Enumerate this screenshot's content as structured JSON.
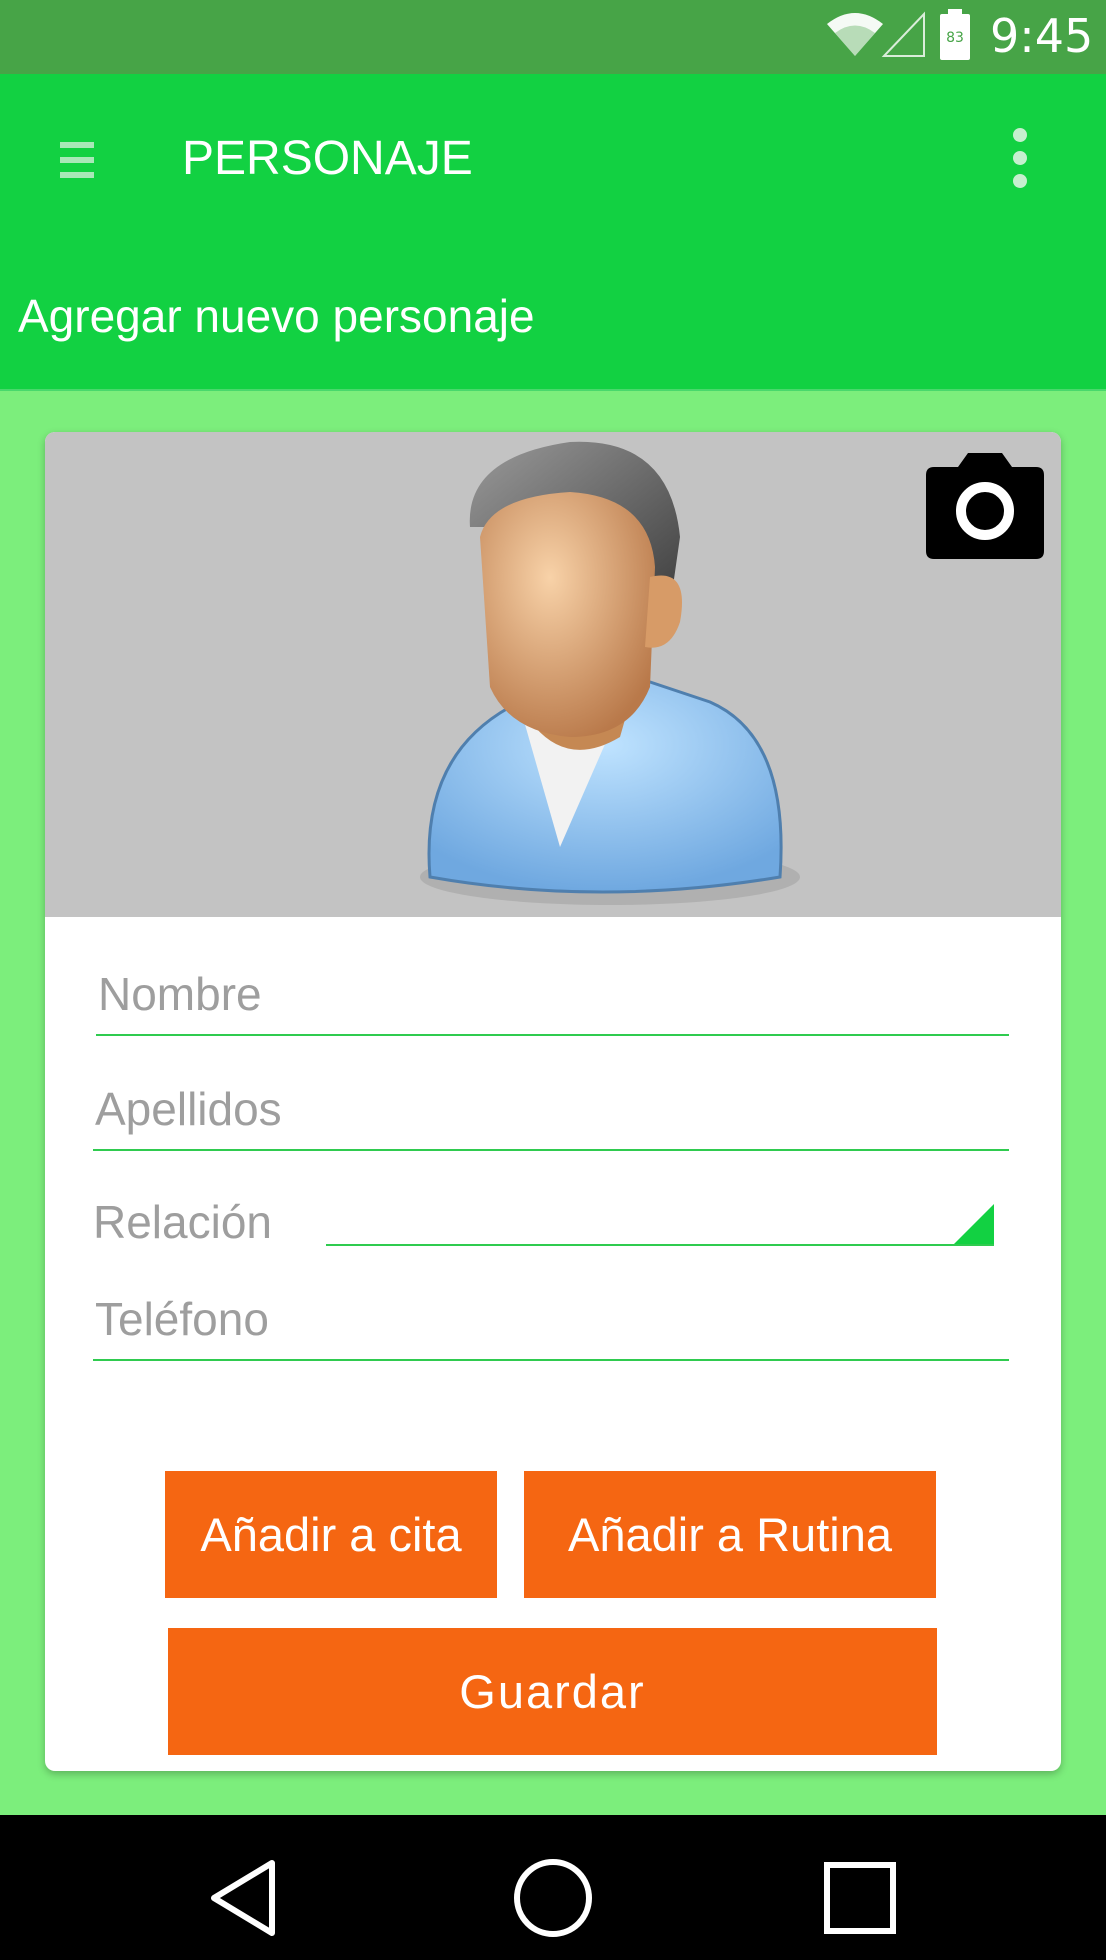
{
  "status_bar": {
    "time": "9:45",
    "battery_level": "83",
    "icons": [
      "wifi-icon",
      "signal-icon",
      "battery-icon"
    ]
  },
  "app_bar": {
    "title": "PERSONAJE",
    "menu_icon": "hamburger-menu-icon",
    "overflow_icon": "more-vert-icon"
  },
  "subheader": {
    "title": "Agregar nuevo personaje"
  },
  "form": {
    "photo": {
      "avatar_icon": "person-avatar",
      "camera_icon": "camera-icon"
    },
    "nombre": {
      "placeholder": "Nombre",
      "value": ""
    },
    "apellidos": {
      "placeholder": "Apellidos",
      "value": ""
    },
    "relacion": {
      "label": "Relación",
      "selected": ""
    },
    "telefono": {
      "placeholder": "Teléfono",
      "value": ""
    }
  },
  "buttons": {
    "anadir_cita": "Añadir a cita",
    "anadir_rutina": "Añadir a Rutina",
    "guardar": "Guardar"
  },
  "nav_bar": {
    "icons": [
      "back-icon",
      "home-icon",
      "recents-icon"
    ]
  },
  "colors": {
    "status_bar": "#47A447",
    "app_bar": "#12D142",
    "background": "#7CEE7C",
    "accent_line": "#2FCB4F",
    "button": "#F56612",
    "photo_bg": "#C3C3C3"
  }
}
